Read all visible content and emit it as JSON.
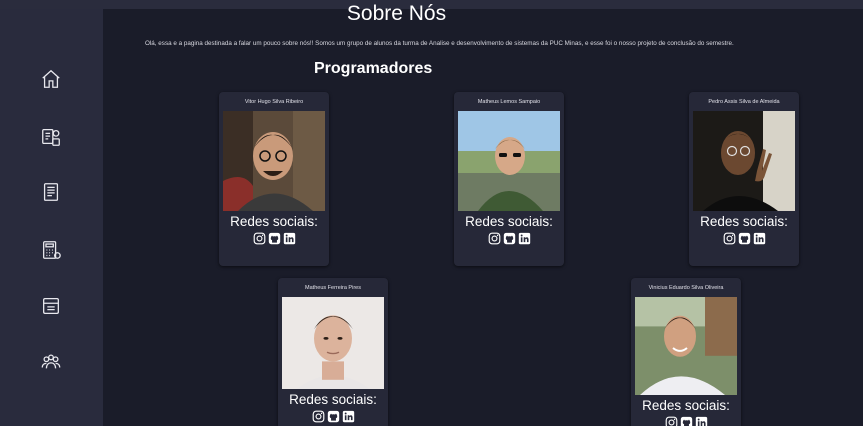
{
  "page": {
    "title": "Sobre Nós",
    "intro": "Olá, essa e a pagina destinada a falar um pouco sobre nós!! Somos um grupo de alunos da turma de Analise e desenvolvimento de sistemas da PUC Minas, e esse foi o nosso projeto de conclusão do semestre.",
    "section_title": "Programadores"
  },
  "sidebar": {
    "items": [
      {
        "icon": "home-icon"
      },
      {
        "icon": "device-settings-icon"
      },
      {
        "icon": "receipt-icon"
      },
      {
        "icon": "calculator-icon"
      },
      {
        "icon": "document-icon"
      },
      {
        "icon": "team-icon"
      }
    ]
  },
  "developers": [
    {
      "name": "Vitor Hugo Silva Ribeiro",
      "social_label": "Redes sociais:"
    },
    {
      "name": "Matheus Lemos Sampaio",
      "social_label": "Redes sociais:"
    },
    {
      "name": "Pedro Assis Silva de Almeida",
      "social_label": "Redes sociais:"
    },
    {
      "name": "Matheus Ferreira Pires",
      "social_label": "Redes sociais:"
    },
    {
      "name": "Vinicius Eduardo Silva Oliveira",
      "social_label": "Redes sociais:"
    }
  ],
  "social_icons": [
    "instagram-icon",
    "github-icon",
    "linkedin-icon"
  ],
  "colors": {
    "background": "#1a1c29",
    "sidebar": "#292b3d",
    "card": "#262838",
    "text": "#ffffff"
  }
}
